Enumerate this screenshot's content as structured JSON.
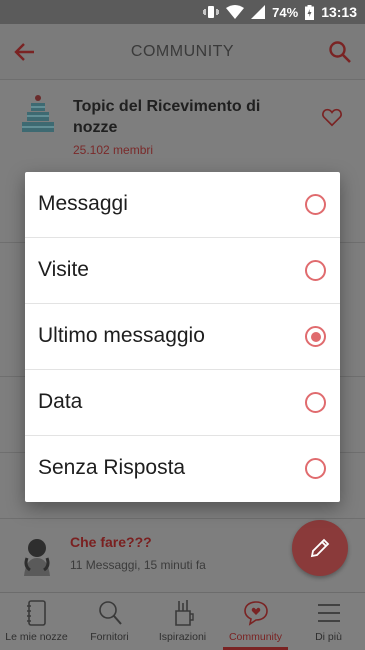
{
  "status_bar": {
    "battery": "74%",
    "time": "13:13"
  },
  "app_bar": {
    "title": "COMMUNITY"
  },
  "group": {
    "name": "Topic del Ricevimento di nozze",
    "members": "25.102 membri"
  },
  "last_item": {
    "title": "Che fare???",
    "meta": "11 Messaggi, 15 minuti fa"
  },
  "sort_dialog": {
    "options": [
      {
        "label": "Messaggi",
        "selected": false
      },
      {
        "label": "Visite",
        "selected": false
      },
      {
        "label": "Ultimo messaggio",
        "selected": true
      },
      {
        "label": "Data",
        "selected": false
      },
      {
        "label": "Senza Risposta",
        "selected": false
      }
    ]
  },
  "bottom_nav": {
    "items": [
      {
        "label": "Le mie nozze",
        "icon": "notebook-icon"
      },
      {
        "label": "Fornitori",
        "icon": "search-icon"
      },
      {
        "label": "Ispirazioni",
        "icon": "pencil-cup-icon"
      },
      {
        "label": "Community",
        "icon": "chat-heart-icon",
        "active": true
      },
      {
        "label": "Di più",
        "icon": "menu-icon"
      }
    ]
  },
  "colors": {
    "accent": "#e06b6e",
    "scrim": "#7e7e7e"
  }
}
